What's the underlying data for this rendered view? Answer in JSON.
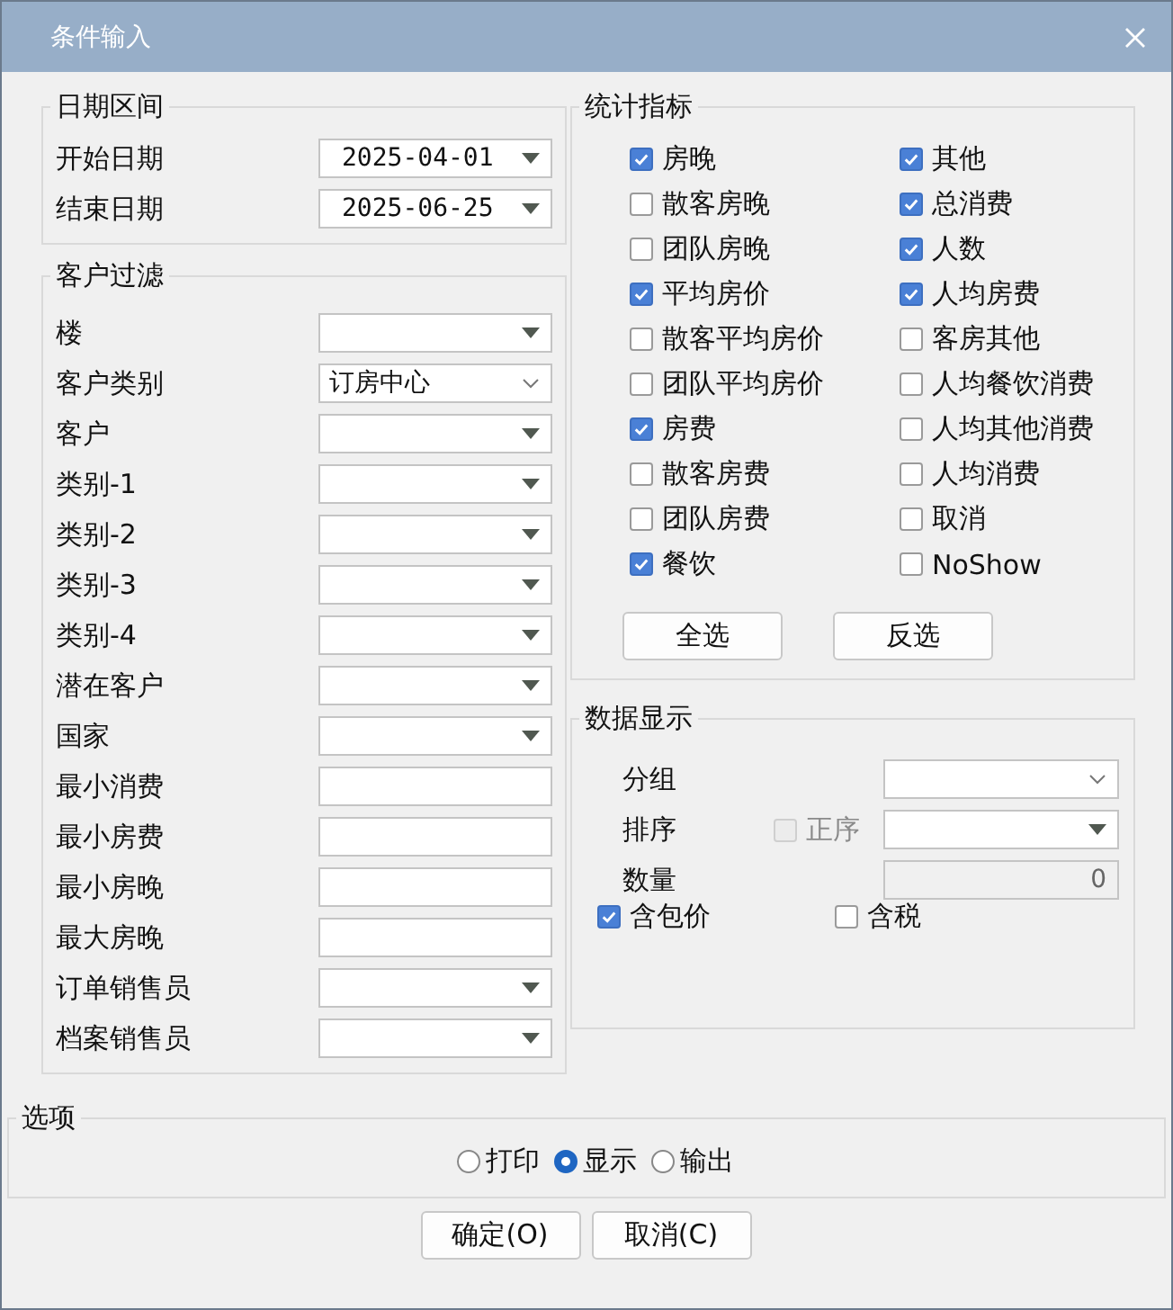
{
  "window": {
    "title": "条件输入"
  },
  "date_range": {
    "legend": "日期区间",
    "fields": [
      {
        "label": "开始日期",
        "kind": "date",
        "value": "2025-04-01"
      },
      {
        "label": "结束日期",
        "kind": "date",
        "value": "2025-06-25"
      }
    ]
  },
  "customer_filter": {
    "legend": "客户过滤",
    "fields": [
      {
        "label": "楼",
        "kind": "select"
      },
      {
        "label": "客户类别",
        "kind": "combo",
        "value": "订房中心"
      },
      {
        "label": "客户",
        "kind": "select"
      },
      {
        "label": "类别-1",
        "kind": "select"
      },
      {
        "label": "类别-2",
        "kind": "select"
      },
      {
        "label": "类别-3",
        "kind": "select"
      },
      {
        "label": "类别-4",
        "kind": "select"
      },
      {
        "label": "潜在客户",
        "kind": "select"
      },
      {
        "label": "国家",
        "kind": "select"
      },
      {
        "label": "最小消费",
        "kind": "text"
      },
      {
        "label": "最小房费",
        "kind": "text"
      },
      {
        "label": "最小房晚",
        "kind": "text"
      },
      {
        "label": "最大房晚",
        "kind": "text"
      },
      {
        "label": "订单销售员",
        "kind": "select"
      },
      {
        "label": "档案销售员",
        "kind": "select"
      }
    ]
  },
  "statistics": {
    "legend": "统计指标",
    "items": [
      {
        "label": "房晚",
        "checked": true
      },
      {
        "label": "散客房晚",
        "checked": false
      },
      {
        "label": "团队房晚",
        "checked": false
      },
      {
        "label": "平均房价",
        "checked": true
      },
      {
        "label": "散客平均房价",
        "checked": false
      },
      {
        "label": "团队平均房价",
        "checked": false
      },
      {
        "label": "房费",
        "checked": true
      },
      {
        "label": "散客房费",
        "checked": false
      },
      {
        "label": "团队房费",
        "checked": false
      },
      {
        "label": "餐饮",
        "checked": true
      },
      {
        "label": "其他",
        "checked": true
      },
      {
        "label": "总消费",
        "checked": true
      },
      {
        "label": "人数",
        "checked": true
      },
      {
        "label": "人均房费",
        "checked": true
      },
      {
        "label": "客房其他",
        "checked": false
      },
      {
        "label": "人均餐饮消费",
        "checked": false
      },
      {
        "label": "人均其他消费",
        "checked": false
      },
      {
        "label": "人均消费",
        "checked": false
      },
      {
        "label": "取消",
        "checked": false
      },
      {
        "label": "NoShow",
        "checked": false
      }
    ],
    "buttons": [
      "全选",
      "反选"
    ]
  },
  "data_display": {
    "legend": "数据显示",
    "group": {
      "label": "分组",
      "kind": "combo"
    },
    "sort": {
      "label": "排序",
      "kind": "select",
      "ascending": {
        "label": "正序",
        "checked": false,
        "disabled": true
      }
    },
    "quantity": {
      "label": "数量",
      "value": "0",
      "disabled": true
    },
    "options": [
      {
        "label": "含包价",
        "checked": true
      },
      {
        "label": "含税",
        "checked": false
      }
    ]
  },
  "options": {
    "legend": "选项",
    "radios": [
      {
        "label": "打印",
        "selected": false
      },
      {
        "label": "显示",
        "selected": true
      },
      {
        "label": "输出",
        "selected": false
      }
    ]
  },
  "buttons": [
    "确定(O)",
    "取消(C)"
  ]
}
